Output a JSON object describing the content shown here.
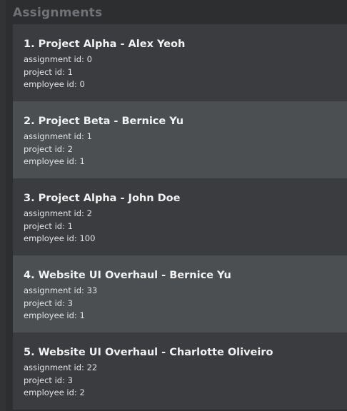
{
  "panel": {
    "title": "Assignments"
  },
  "assignments": [
    {
      "title": "1. Project Alpha - Alex Yeoh",
      "assignment_id": "assignment id: 0",
      "project_id": "project id: 1",
      "employee_id": "employee id: 0"
    },
    {
      "title": "2. Project Beta - Bernice Yu",
      "assignment_id": "assignment id: 1",
      "project_id": "project id: 2",
      "employee_id": "employee id: 1"
    },
    {
      "title": "3. Project Alpha - John Doe",
      "assignment_id": "assignment id: 2",
      "project_id": "project id: 1",
      "employee_id": "employee id: 100"
    },
    {
      "title": "4. Website UI Overhaul - Bernice Yu",
      "assignment_id": "assignment id: 33",
      "project_id": "project id: 3",
      "employee_id": "employee id: 1"
    },
    {
      "title": "5. Website UI Overhaul - Charlotte Oliveiro",
      "assignment_id": "assignment id: 22",
      "project_id": "project id: 3",
      "employee_id": "employee id: 2"
    }
  ],
  "colors": {
    "background": "#2d2e30",
    "card": "#3b3c3f",
    "card_alt": "#4b4f52",
    "title_text": "#f2f2f2",
    "heading_text": "#6f7377"
  }
}
